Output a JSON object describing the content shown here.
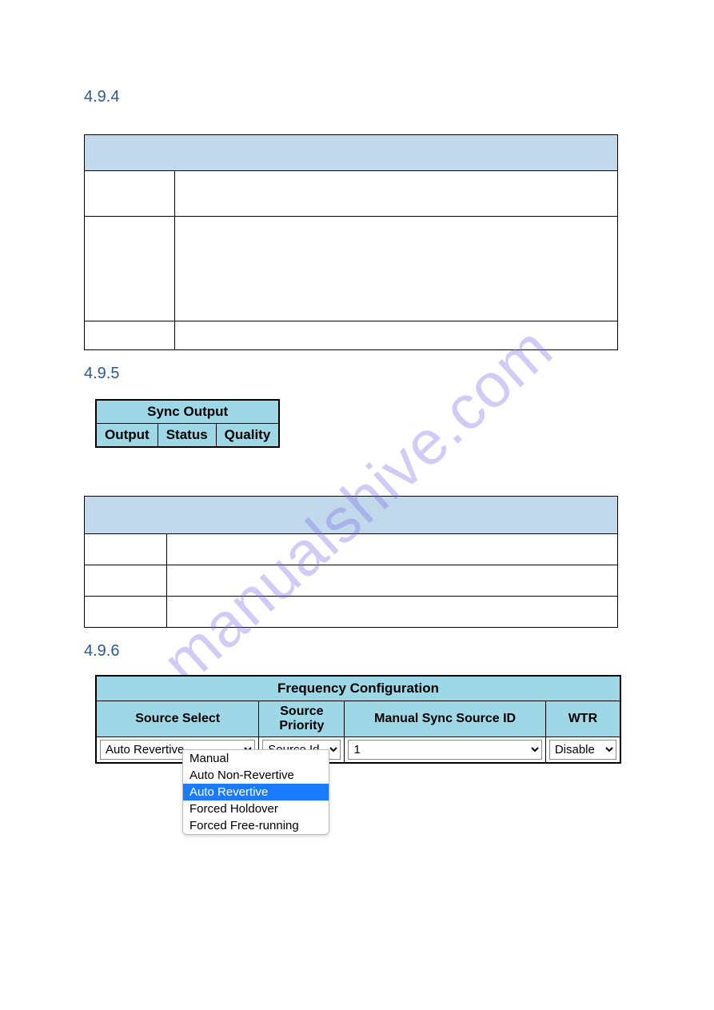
{
  "sections": {
    "s494": "4.9.4",
    "s495": "4.9.5",
    "s496": "4.9.6"
  },
  "sync_output": {
    "title": "Sync Output",
    "cols": [
      "Output",
      "Status",
      "Quality"
    ]
  },
  "freq_config": {
    "title": "Frequency Configuration",
    "headers": {
      "source_select": "Source Select",
      "source_priority": "Source Priority",
      "manual_sync": "Manual Sync Source ID",
      "wtr": "WTR"
    },
    "values": {
      "source_select": "Auto Revertive",
      "source_priority": "Source Id",
      "manual_sync": "1",
      "wtr": "Disable"
    },
    "source_select_options": [
      "Manual",
      "Auto Non-Revertive",
      "Auto Revertive",
      "Forced Holdover",
      "Forced Free-running"
    ]
  },
  "watermark": "manualshive.com"
}
